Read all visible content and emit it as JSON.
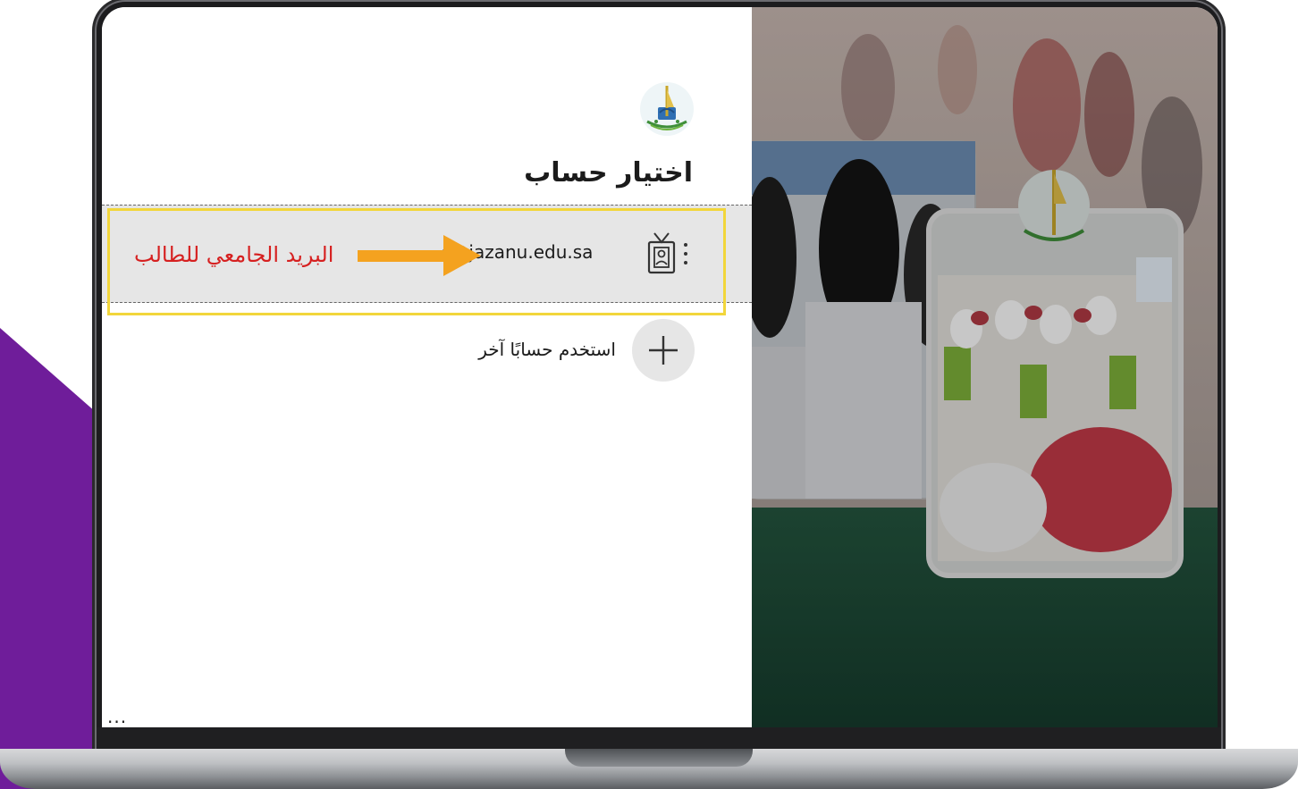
{
  "page": {
    "title": "اختيار حساب",
    "account": {
      "email": "s@jazanu.edu.sa",
      "annotation": "البريد الجامعي للطالب"
    },
    "add_account": {
      "label": "استخدم حسابًا آخر"
    },
    "more_options": "..."
  },
  "colors": {
    "purple": "#6f1d9a",
    "highlight_border": "#f2d63b",
    "arrow": "#f4a21f",
    "annotation_text": "#d62020",
    "row_bg": "#e6e6e6",
    "green_panel": "#1d4b39"
  },
  "icons": [
    "university-logo-icon",
    "badge-icon",
    "kebab-menu-icon",
    "plus-icon",
    "arrow-icon"
  ]
}
